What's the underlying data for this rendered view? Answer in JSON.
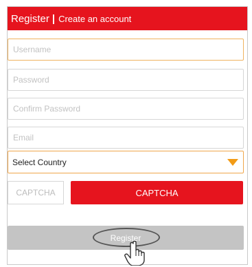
{
  "header": {
    "title": "Register",
    "separator": "|",
    "subtitle": "Create an account"
  },
  "form": {
    "username_placeholder": "Username",
    "password_placeholder": "Password",
    "confirm_password_placeholder": "Confirm Password",
    "email_placeholder": "Email",
    "country_select": "Select Country",
    "captcha_placeholder": "CAPTCHA",
    "captcha_button": "CAPTCHA",
    "register_button": "Register"
  },
  "colors": {
    "brand_red": "#e6141e",
    "focus_orange": "#f0b35e",
    "dropdown_arrow": "#f29b16",
    "disabled_button": "#c4c4c4"
  },
  "icons": {
    "dropdown": "triangle-down-icon",
    "pointer": "pointing-hand-icon"
  }
}
